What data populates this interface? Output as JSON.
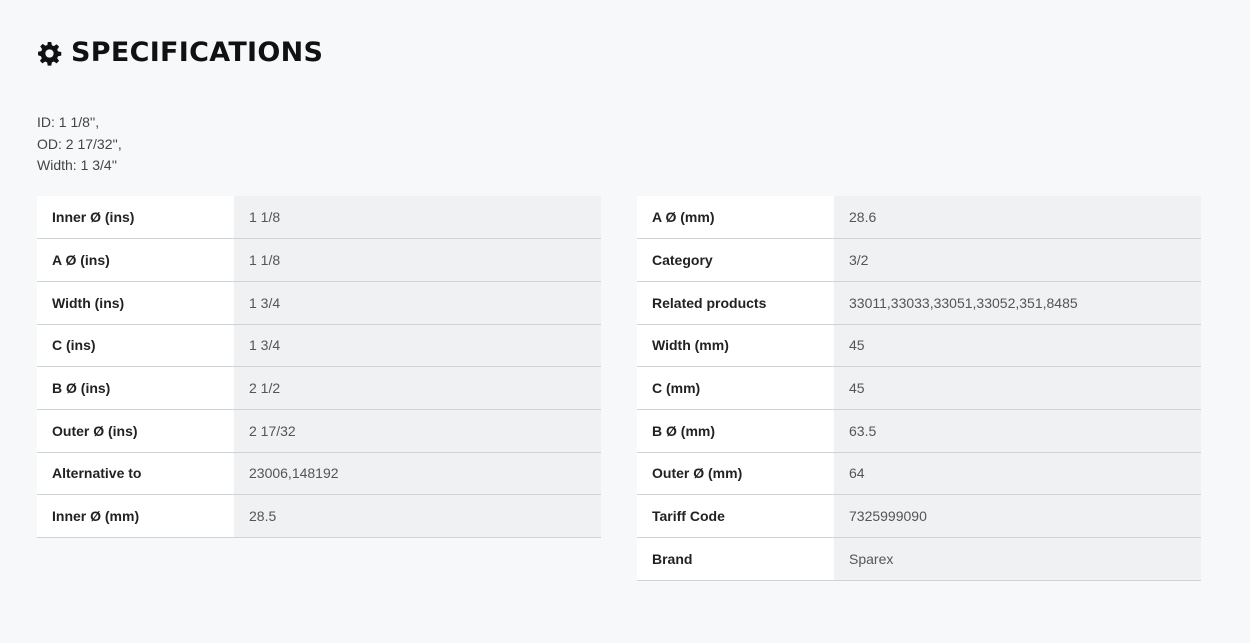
{
  "heading": {
    "title": "SPECIFICATIONS",
    "icon": "gear-icon"
  },
  "summary": [
    "ID: 1 1/8'',",
    "OD: 2 17/32'',",
    "Width: 1 3/4''"
  ],
  "left_table": [
    {
      "label": "Inner Ø (ins)",
      "value": "1 1/8"
    },
    {
      "label": "A Ø (ins)",
      "value": "1 1/8"
    },
    {
      "label": "Width (ins)",
      "value": "1 3/4"
    },
    {
      "label": "C (ins)",
      "value": "1 3/4"
    },
    {
      "label": "B Ø (ins)",
      "value": "2 1/2"
    },
    {
      "label": "Outer Ø (ins)",
      "value": "2 17/32"
    },
    {
      "label": "Alternative to",
      "value": "23006,148192"
    },
    {
      "label": "Inner Ø (mm)",
      "value": "28.5"
    }
  ],
  "right_table": [
    {
      "label": "A Ø (mm)",
      "value": "28.6"
    },
    {
      "label": "Category",
      "value": "3/2"
    },
    {
      "label": "Related products",
      "value": "33011,33033,33051,33052,351,8485"
    },
    {
      "label": "Width (mm)",
      "value": "45"
    },
    {
      "label": "C (mm)",
      "value": "45"
    },
    {
      "label": "B Ø (mm)",
      "value": "63.5"
    },
    {
      "label": "Outer Ø (mm)",
      "value": "64"
    },
    {
      "label": "Tariff Code",
      "value": "7325999090"
    },
    {
      "label": "Brand",
      "value": "Sparex"
    }
  ]
}
